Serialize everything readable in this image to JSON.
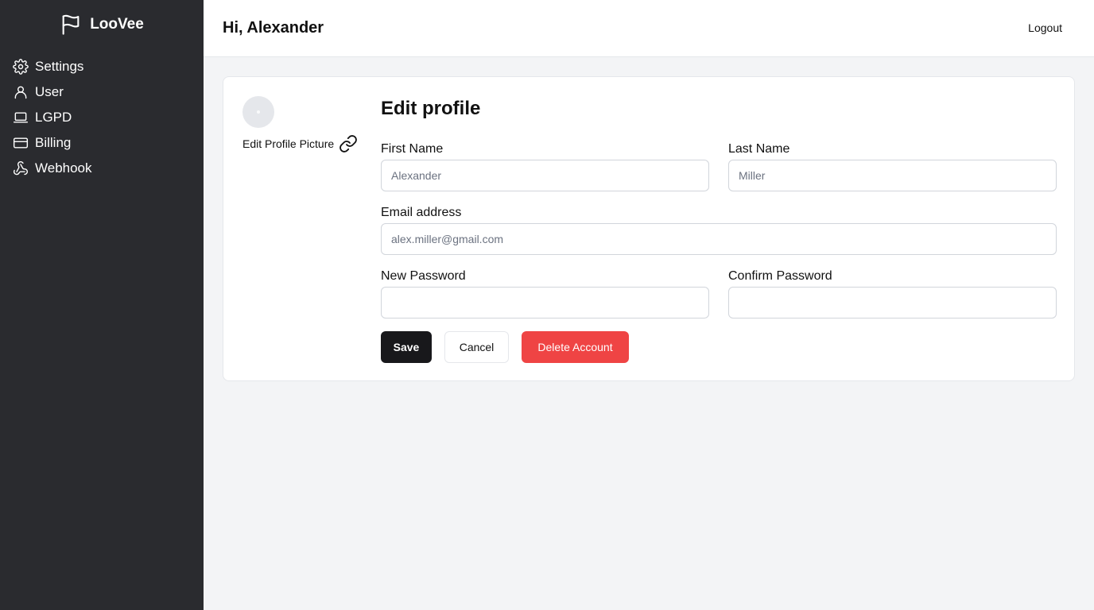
{
  "sidebar": {
    "brand": {
      "name": "LooVee",
      "icon": "flag-icon"
    },
    "items": [
      {
        "label": "Settings",
        "icon": "gear-icon"
      },
      {
        "label": "User",
        "icon": "user-icon"
      },
      {
        "label": "LGPD",
        "icon": "laptop-icon"
      },
      {
        "label": "Billing",
        "icon": "credit-card-icon"
      },
      {
        "label": "Webhook",
        "icon": "webhook-icon"
      }
    ]
  },
  "header": {
    "greeting": "Hi, Alexander",
    "logout_label": "Logout"
  },
  "profile": {
    "edit_picture_label": "Edit Profile Picture",
    "edit_picture_icon": "link-icon",
    "title": "Edit profile",
    "fields": {
      "first_name": {
        "label": "First Name",
        "placeholder": "Alexander",
        "value": ""
      },
      "last_name": {
        "label": "Last Name",
        "placeholder": "Miller",
        "value": ""
      },
      "email": {
        "label": "Email address",
        "placeholder": "alex.miller@gmail.com",
        "value": ""
      },
      "new_password": {
        "label": "New Password",
        "placeholder": "",
        "value": ""
      },
      "confirm_password": {
        "label": "Confirm Password",
        "placeholder": "",
        "value": ""
      }
    },
    "buttons": {
      "save": "Save",
      "cancel": "Cancel",
      "delete": "Delete Account"
    }
  },
  "colors": {
    "sidebar_bg": "#2a2b2f",
    "page_bg": "#f3f4f6",
    "primary_button": "#18181b",
    "danger_button": "#ef4444"
  }
}
